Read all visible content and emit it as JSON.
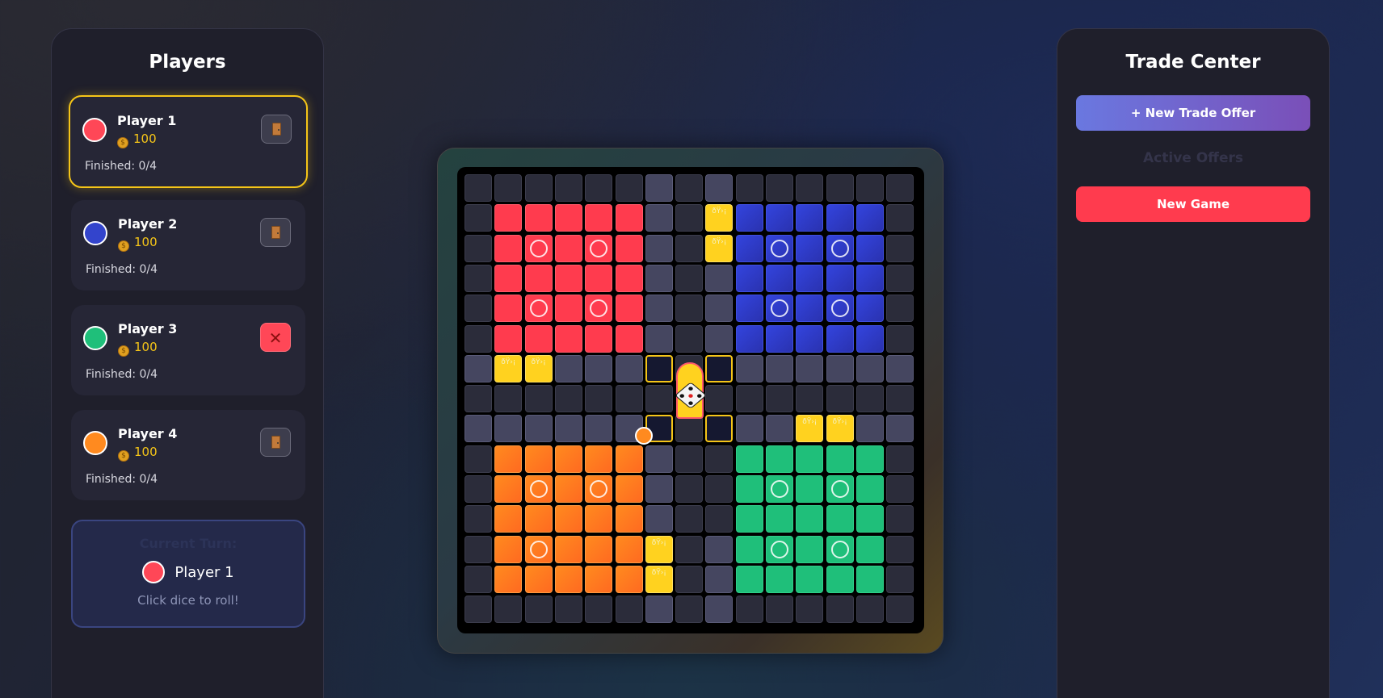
{
  "players_panel": {
    "title": "Players",
    "players": [
      {
        "name": "Player 1",
        "coins": "100",
        "finished": "Finished: 0/4",
        "color": "#ff4757",
        "action_icon": "door-icon"
      },
      {
        "name": "Player 2",
        "coins": "100",
        "finished": "Finished: 0/4",
        "color": "#3344cc",
        "action_icon": "door-icon"
      },
      {
        "name": "Player 3",
        "coins": "100",
        "finished": "Finished: 0/4",
        "color": "#1fbf7a",
        "action_icon": "cross-mark-icon"
      },
      {
        "name": "Player 4",
        "coins": "100",
        "finished": "Finished: 0/4",
        "color": "#ff8a1f",
        "action_icon": "door-icon"
      }
    ],
    "active_player_index": 0
  },
  "current_turn": {
    "label": "Current Turn:",
    "player_name": "Player 1",
    "player_color": "#ff4757",
    "hint": "Click dice to roll!"
  },
  "trade_center": {
    "title": "Trade Center",
    "new_offer_label": "+ New Trade Offer",
    "active_offers_label": "Active Offers",
    "new_game_label": "New Game"
  },
  "board": {
    "safe_cell_text": "ðŸ›¡",
    "dice_icon": "dice-icon",
    "colors": {
      "red": "#ff3b4e",
      "blue": "#3344dd",
      "green": "#1fbf7a",
      "orange": "#ff8a1f",
      "yellow": "#ffd21f"
    }
  }
}
